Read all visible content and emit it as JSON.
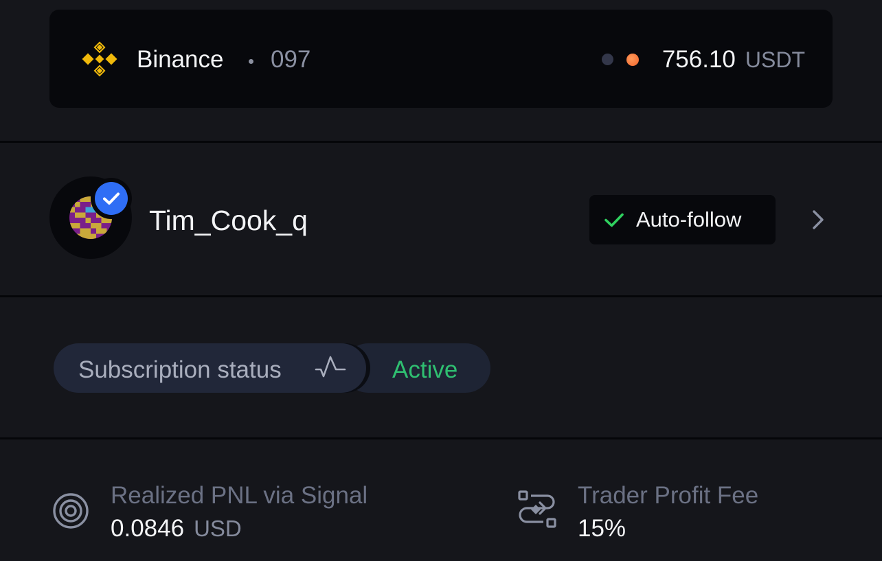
{
  "exchange": {
    "name": "Binance",
    "account": "097",
    "balance": "756.10",
    "balance_unit": "USDT",
    "status_dot_colors": [
      "#33374a",
      "#f2652d"
    ]
  },
  "trader": {
    "name": "Tim_Cook_q",
    "verified": true,
    "auto_follow_label": "Auto-follow"
  },
  "subscription": {
    "label": "Subscription status",
    "status": "Active",
    "status_color": "#2fbf71"
  },
  "stats": {
    "pnl": {
      "label": "Realized PNL via Signal",
      "value": "0.0846",
      "unit": "USD",
      "icon": "target-rings-icon"
    },
    "fee": {
      "label": "Trader Profit Fee",
      "value": "15%",
      "icon": "exchange-flow-icon"
    }
  },
  "colors": {
    "background": "#15161b",
    "card": "#07080c",
    "accent_blue": "#2f6ef5",
    "binance_yellow": "#f0b90b",
    "success_green": "#2fbf71"
  }
}
